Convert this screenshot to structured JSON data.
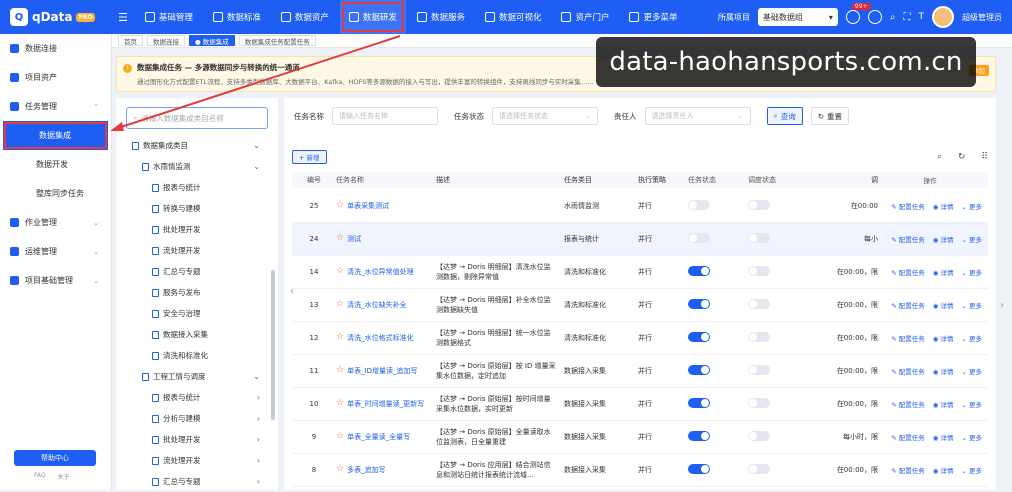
{
  "app": {
    "logo_text": "qData",
    "logo_badge": "PRO"
  },
  "topnav": {
    "items": [
      {
        "label": "基础管理"
      },
      {
        "label": "数据标准"
      },
      {
        "label": "数据资产"
      },
      {
        "label": "数据研发"
      },
      {
        "label": "数据服务"
      },
      {
        "label": "数据可视化"
      },
      {
        "label": "资产门户"
      },
      {
        "label": "更多菜单"
      }
    ],
    "project_label": "所属项目",
    "project_value": "基础数据组",
    "notify_count": "99+",
    "user": "超级管理员"
  },
  "sidebar": {
    "items": [
      {
        "label": "数据连接"
      },
      {
        "label": "项目资产"
      },
      {
        "label": "任务管理"
      },
      {
        "label": "作业管理"
      },
      {
        "label": "运维管理"
      },
      {
        "label": "项目基础管理"
      }
    ],
    "sub": [
      {
        "label": "数据集成"
      },
      {
        "label": "数据开发"
      },
      {
        "label": "整库同步任务"
      }
    ],
    "help": "帮助中心",
    "footer": [
      "FAQ",
      "关于"
    ]
  },
  "tabs": [
    {
      "label": "首页"
    },
    {
      "label": "数据连接"
    },
    {
      "label": "● 数据集成"
    },
    {
      "label": "数据集成任务配置任务"
    }
  ],
  "notice": {
    "title": "数据集成任务 — 多源数据同步与转换的统一通道",
    "desc": "通过图形化方式配置ETL流程，支持多类型数据库、大数据平台、Kafka、HDFS等多源数据的接入与写出，提供丰富的转换组件，支持离线同步与实时采集……",
    "tag": "收起"
  },
  "watermark": "data-haohansports.com.cn",
  "tree": {
    "search_placeholder": "请输入数据集成类目名称",
    "root": "数据集成类目",
    "group1": "水雨情监测",
    "group1_items": [
      "报表与统计",
      "转换与建模",
      "批处理开发",
      "流处理开发",
      "汇总与专题",
      "服务与发布",
      "安全与治理",
      "数据接入采集",
      "清洗和标准化"
    ],
    "group2": "工程工情与调度",
    "group2_items": [
      "报表与统计",
      "分析与建模",
      "批处理开发",
      "流处理开发",
      "汇总与专题"
    ]
  },
  "filters": {
    "name_label": "任务名称",
    "name_placeholder": "请输入任务名称",
    "status_label": "任务状态",
    "status_placeholder": "请选择任务状态",
    "owner_label": "责任人",
    "owner_placeholder": "请选择责任人",
    "query": "查询",
    "reset": "重置",
    "add": "+ 新增"
  },
  "table": {
    "headers": [
      "编号",
      "任务名称",
      "描述",
      "任务类目",
      "执行策略",
      "任务状态",
      "调度状态",
      "调",
      "操作"
    ],
    "op_labels": [
      "配置任务",
      "详情",
      "更多"
    ],
    "rows": [
      {
        "no": "25",
        "name": "单表采集测试",
        "desc": "",
        "cat": "水雨情监测",
        "exec": "并行",
        "ts": false,
        "ds": false,
        "sch": "在00:00"
      },
      {
        "no": "24",
        "name": "测试",
        "desc": "",
        "cat": "报表与统计",
        "exec": "并行",
        "ts": false,
        "ds": false,
        "sch": "每小"
      },
      {
        "no": "14",
        "name": "清洗_水位异常值处理",
        "desc": "【达梦 → Doris 明细层】清洗水位监测数据，剔除异常值",
        "cat": "清洗和标准化",
        "exec": "并行",
        "ts": true,
        "ds": false,
        "sch": "在00:00，限"
      },
      {
        "no": "13",
        "name": "清洗_水位缺失补全",
        "desc": "【达梦 → Doris 明细层】补全水位监测数据缺失值",
        "cat": "清洗和标准化",
        "exec": "并行",
        "ts": true,
        "ds": false,
        "sch": "在00:00，限"
      },
      {
        "no": "12",
        "name": "清洗_水位格式标准化",
        "desc": "【达梦 → Doris 明细层】统一水位监测数据格式",
        "cat": "清洗和标准化",
        "exec": "并行",
        "ts": true,
        "ds": false,
        "sch": "在00:00，限"
      },
      {
        "no": "11",
        "name": "单表_ID增量读_追加写",
        "desc": "【达梦 → Doris 原始层】按 ID 增量采集水位数据，定时追加",
        "cat": "数据接入采集",
        "exec": "并行",
        "ts": true,
        "ds": false,
        "sch": "在00:00，限"
      },
      {
        "no": "10",
        "name": "单表_时间增量读_更新写",
        "desc": "【达梦 → Doris 原始层】按时间增量采集水位数据，实时更新",
        "cat": "数据接入采集",
        "exec": "并行",
        "ts": true,
        "ds": false,
        "sch": "在00:00，限"
      },
      {
        "no": "9",
        "name": "单表_全量读_全量写",
        "desc": "【达梦 → Doris 原始层】全量读取水位监测表，日全量重建",
        "cat": "数据接入采集",
        "exec": "并行",
        "ts": true,
        "ds": false,
        "sch": "每小时，限"
      },
      {
        "no": "8",
        "name": "多表_追加写",
        "desc": "【达梦 → Doris 应用层】结合测站信息和测站日统计报表统计流域…",
        "cat": "数据接入采集",
        "exec": "并行",
        "ts": true,
        "ds": false,
        "sch": "在00:00，限"
      }
    ]
  }
}
